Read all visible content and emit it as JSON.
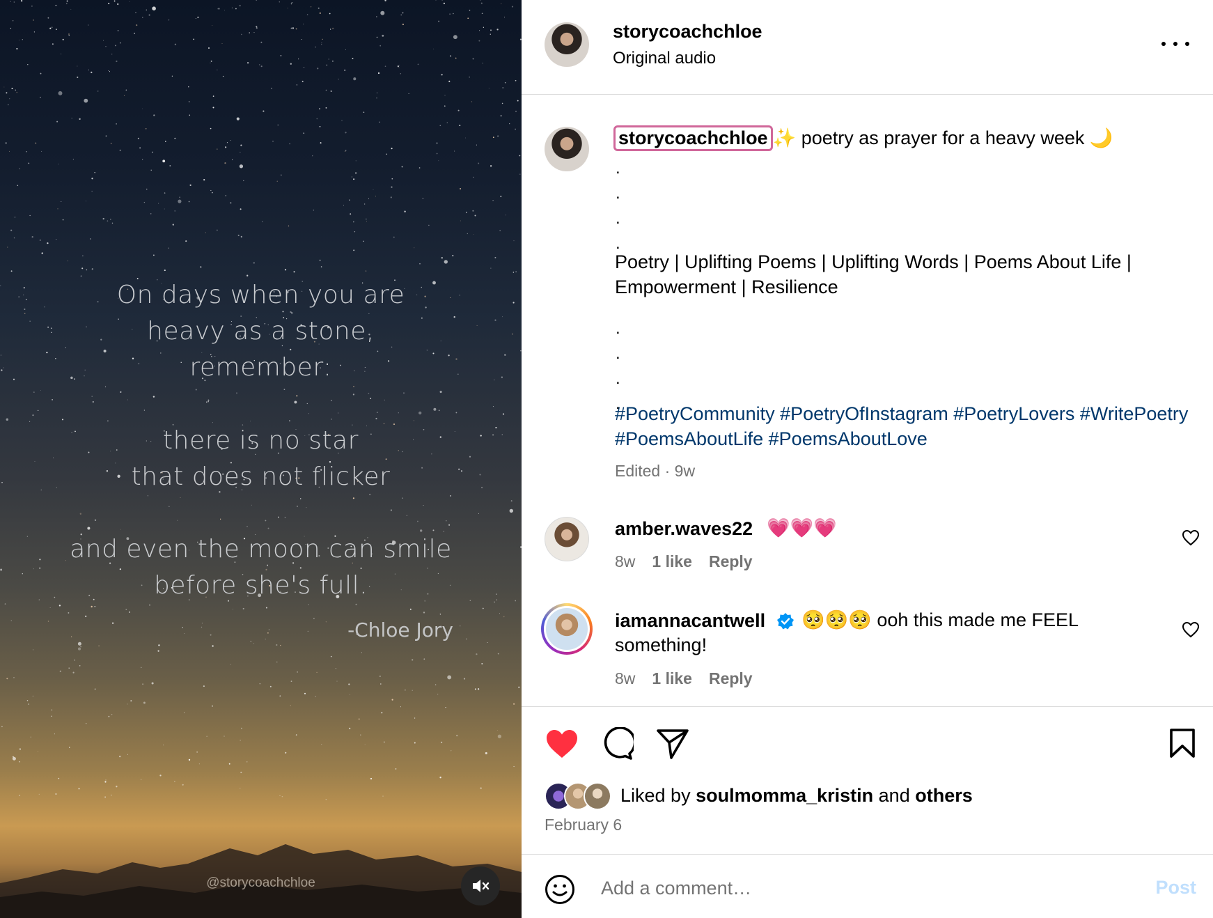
{
  "media": {
    "poem_lines_1": [
      "On days when you are",
      "heavy as a stone,",
      "remember:"
    ],
    "poem_lines_2": [
      "there is no star",
      "that does not flicker"
    ],
    "poem_lines_3": [
      "and even the moon can smile",
      "before she's full."
    ],
    "signature": "-Chloe Jory",
    "watermark": "@storycoachchloe",
    "mute_icon": "speaker-muted-icon"
  },
  "header": {
    "username": "storycoachchloe",
    "audio": "Original audio",
    "more_icon": "more-options-icon"
  },
  "caption": {
    "username": "storycoachchloe",
    "sparkle": "✨",
    "text": " poetry as prayer for a heavy week ",
    "moon": "🌙",
    "dots_a": [
      ".",
      ".",
      ".",
      "."
    ],
    "keywords": "Poetry | Uplifting Poems | Uplifting Words | Poems About Life | Empowerment | Resilience",
    "dots_b": [
      ".",
      ".",
      ".",
      "."
    ],
    "hashtags": [
      "#PoetryCommunity",
      "#PoetryOfInstagram",
      "#PoetryLovers",
      "#WritePoetry",
      "#PoemsAboutLife",
      "#PoemsAboutLove"
    ],
    "meta": "Edited · 9w"
  },
  "comments": [
    {
      "username": "amber.waves22",
      "text": "💗💗💗",
      "age": "8w",
      "likes": "1 like",
      "reply": "Reply"
    },
    {
      "username": "iamannacantwell",
      "verified": true,
      "text": "🥺🥺🥺 ooh this made me FEEL something!",
      "age": "8w",
      "likes": "1 like",
      "reply": "Reply"
    }
  ],
  "actions": {
    "liked": true,
    "like_color": "#ff3040",
    "liked_by_prefix": "Liked by ",
    "liked_by_user": "soulmomma_kristin",
    "liked_by_mid": " and ",
    "liked_by_others": "others",
    "date": "February 6"
  },
  "add_comment": {
    "placeholder": "Add a comment…",
    "post_label": "Post"
  },
  "colors": {
    "link_blue": "#00376b",
    "muted": "#737373",
    "post_disabled": "#c0dffd",
    "highlight_border": "#d0679a",
    "verified_blue": "#0095f6"
  }
}
